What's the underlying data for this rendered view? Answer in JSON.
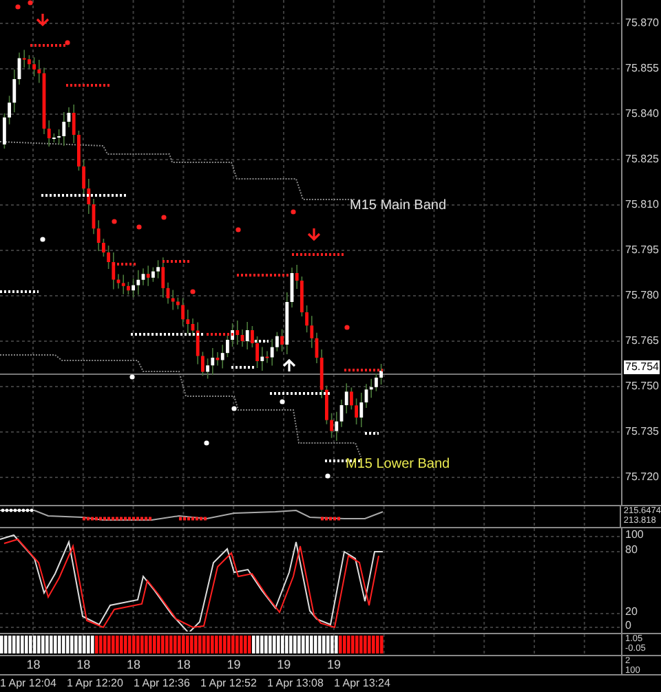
{
  "price_axis": {
    "labels": [
      "75.870",
      "75.855",
      "75.840",
      "75.825",
      "75.810",
      "75.795",
      "75.780",
      "75.765",
      "75.750",
      "75.735",
      "75.720"
    ],
    "current_price": "75.754"
  },
  "annotations": [
    {
      "text": "M15 Main Band",
      "kind": "main"
    },
    {
      "text": "M15 Lower Band",
      "kind": "lower"
    }
  ],
  "indicator_panes": [
    {
      "kind": "line",
      "labels": [
        "215.6474",
        "213.818"
      ]
    },
    {
      "kind": "stochastic",
      "labels": [
        "100",
        "80",
        "20",
        "0"
      ]
    },
    {
      "kind": "histogram",
      "labels": [
        "1.05",
        "-0.05"
      ]
    },
    {
      "kind": "blank",
      "labels": [
        "2",
        "100"
      ]
    }
  ],
  "pane_grid_labels": [
    "18",
    "18",
    "18",
    "18",
    "19",
    "19",
    "19"
  ],
  "time_axis": [
    "1 Apr 12:04",
    "1 Apr 12:20",
    "1 Apr 12:36",
    "1 Apr 12:52",
    "1 Apr 13:08",
    "1 Apr 13:24"
  ]
}
